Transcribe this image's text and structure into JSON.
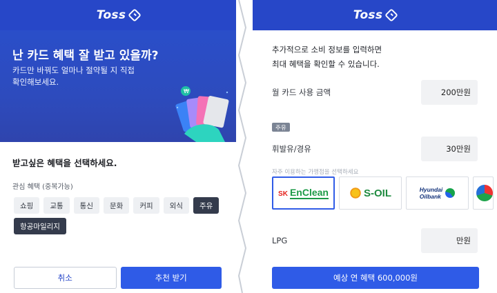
{
  "left": {
    "brand": "Toss",
    "hero": {
      "title": "난 카드 혜택 잘 받고 있을까?",
      "subtitle": "카드만 바꿔도 얼마나 절약될 지 직접 확인해보세요."
    },
    "section_title": "받고싶은 혜택을 선택하세요.",
    "interest_label": "관심 혜택 (중복가능)",
    "chips": [
      {
        "label": "쇼핑",
        "active": false
      },
      {
        "label": "교통",
        "active": false
      },
      {
        "label": "통신",
        "active": false
      },
      {
        "label": "문화",
        "active": false
      },
      {
        "label": "커피",
        "active": false
      },
      {
        "label": "외식",
        "active": false
      },
      {
        "label": "주유",
        "active": true
      },
      {
        "label": "항공마일리지",
        "active": true
      }
    ],
    "buttons": {
      "cancel": "취소",
      "recommend": "추천 받기"
    }
  },
  "right": {
    "brand": "Toss",
    "intro_line1": "추가적으로 소비 정보를 입력하면",
    "intro_line2": "최대 혜택을 확인할 수 있습니다.",
    "card_spend": {
      "label": "월 카드 사용 금액",
      "value": "200만원"
    },
    "fuel_tag": "주유",
    "fuel": {
      "label": "휘발유/경유",
      "value": "30만원"
    },
    "station_hint": "자주 이용하는 가맹점을 선택하세요",
    "stations": [
      {
        "name": "SK EnClean",
        "sk": "SK",
        "en": "EnClean",
        "selected": true
      },
      {
        "name": "S-OIL",
        "selected": false
      },
      {
        "name": "Hyundai Oilbank",
        "line1": "Hyundai",
        "line2": "Oilbank",
        "selected": false
      }
    ],
    "lpg": {
      "label": "LPG",
      "value": "만원"
    },
    "cta": "예상 연 혜택 600,000원"
  },
  "colors": {
    "brand_blue": "#2747c8",
    "primary_button": "#2f5be7",
    "chip_active": "#343b4c"
  }
}
